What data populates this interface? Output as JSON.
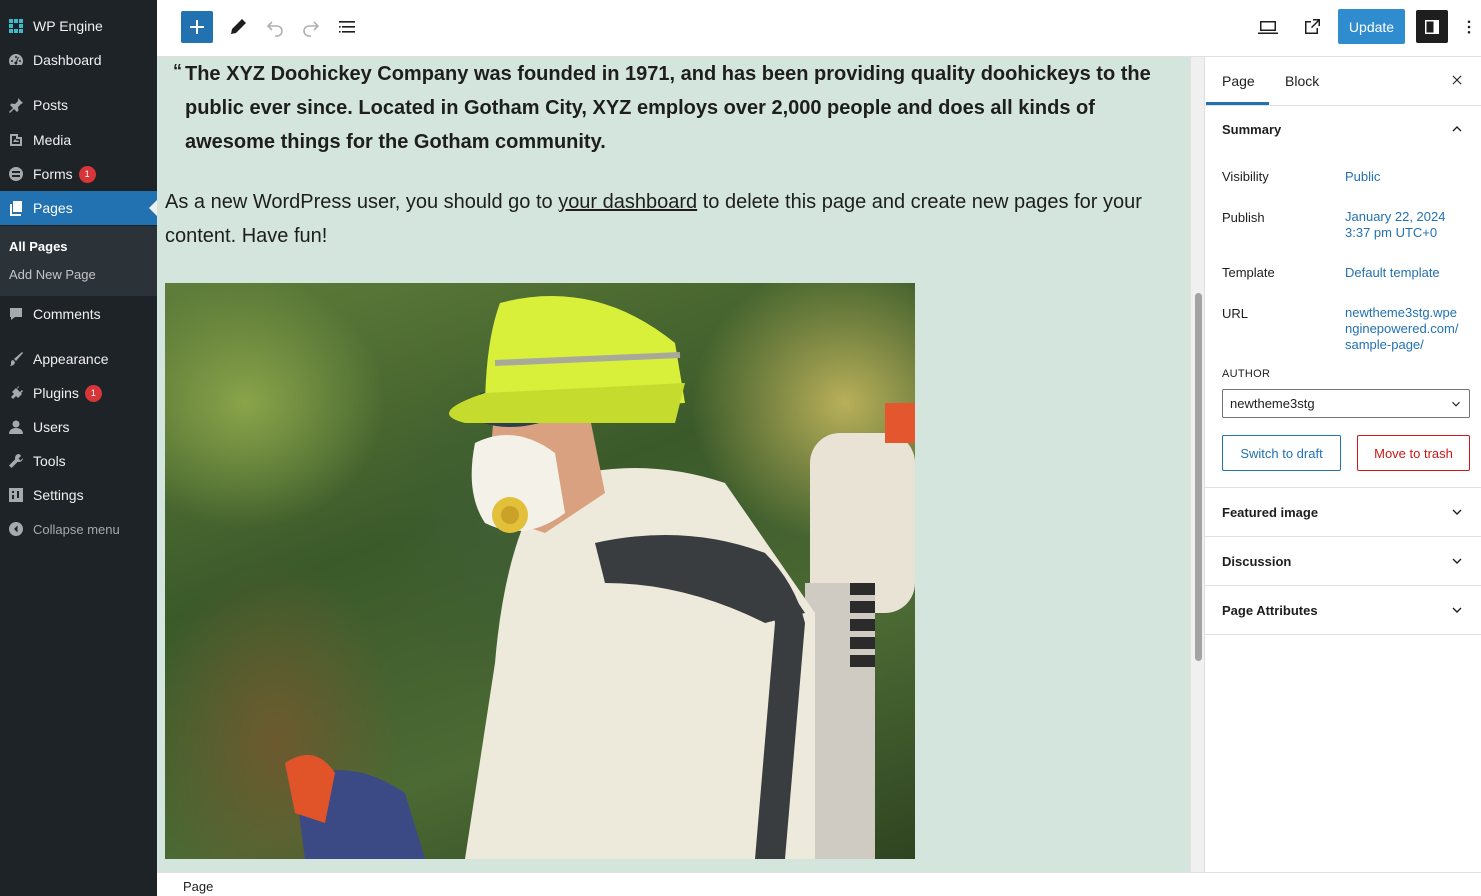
{
  "admin_menu": {
    "site_name": "WP Engine",
    "items": [
      {
        "label": "Dashboard",
        "icon": "dashboard-icon"
      },
      {
        "label": "Posts",
        "icon": "pin-icon"
      },
      {
        "label": "Media",
        "icon": "media-icon"
      },
      {
        "label": "Forms",
        "icon": "forms-icon",
        "badge": "1"
      },
      {
        "label": "Pages",
        "icon": "pages-icon"
      },
      {
        "label": "Comments",
        "icon": "comment-icon"
      },
      {
        "label": "Appearance",
        "icon": "brush-icon"
      },
      {
        "label": "Plugins",
        "icon": "plug-icon",
        "badge": "1"
      },
      {
        "label": "Users",
        "icon": "user-icon"
      },
      {
        "label": "Tools",
        "icon": "wrench-icon"
      },
      {
        "label": "Settings",
        "icon": "settings-icon"
      }
    ],
    "submenu": [
      "All Pages",
      "Add New Page"
    ],
    "collapse_label": "Collapse menu",
    "active_color": "#2271b1"
  },
  "toolbar": {
    "update_label": "Update",
    "accent_color": "#2271b1"
  },
  "content": {
    "quote_mark": "“",
    "quote": "The XYZ Doohickey Company was founded in 1971, and has been providing quality doohickeys to the public ever since. Located in Gotham City, XYZ employs over 2,000 people and does all kinds of awesome things for the Gotham community.",
    "para_before": "As a new WordPress user, you should go to ",
    "para_link": "your dashboard",
    "para_after": " to delete this page and create new pages for your content. Have fun!",
    "image_subject": "worker in protective suit, respirator mask and yellow cap with sprayer backpack",
    "background_color": "#d4e5de"
  },
  "panel": {
    "tabs": [
      "Page",
      "Block"
    ],
    "summary_title": "Summary",
    "rows": [
      {
        "label": "Visibility",
        "value": "Public"
      },
      {
        "label": "Publish",
        "value": "January 22, 2024 3:37 pm UTC+0"
      },
      {
        "label": "Template",
        "value": "Default template"
      },
      {
        "label": "URL",
        "value": "newtheme3stg.wpenginepowered.com/sample-page/"
      }
    ],
    "author_label": "AUTHOR",
    "author_value": "newtheme3stg",
    "switch_draft": "Switch to draft",
    "move_trash": "Move to trash",
    "sections": [
      "Featured image",
      "Discussion",
      "Page Attributes"
    ]
  },
  "footer": {
    "breadcrumb": "Page"
  }
}
